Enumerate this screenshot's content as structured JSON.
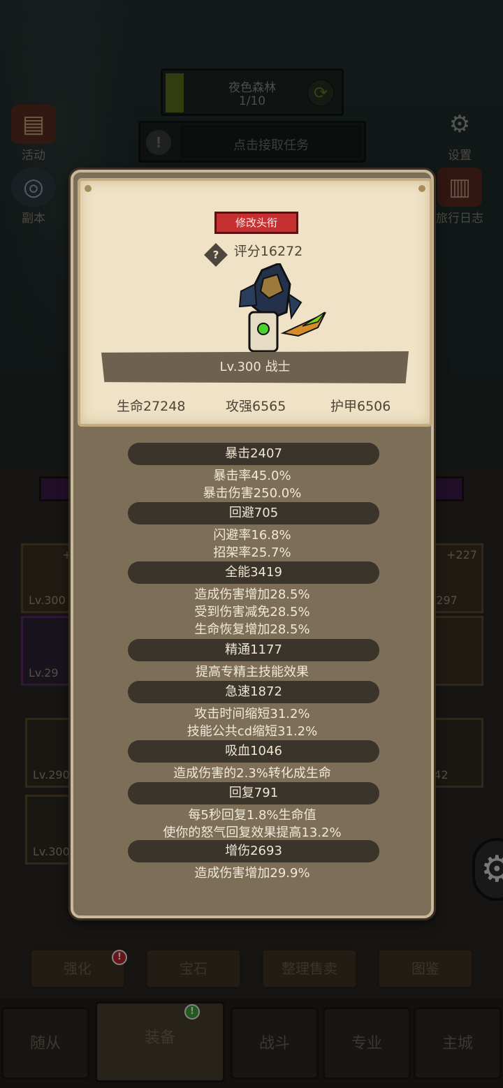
{
  "hud": {
    "level_name": "夜色森林",
    "level_progress": "1/10",
    "task_text": "点击接取任务",
    "left_buttons": [
      {
        "label": "活动",
        "icon": "scroll-icon"
      },
      {
        "label": "副本",
        "icon": "portal-icon"
      }
    ],
    "right_buttons": [
      {
        "label": "设置",
        "icon": "gear-icon"
      },
      {
        "label": "旅行日志",
        "icon": "book-icon"
      }
    ]
  },
  "background_slots": [
    {
      "lv": "Lv.300",
      "plus": "+2"
    },
    {
      "lv": "Lv.29",
      "plus": ""
    },
    {
      "lv": "v.297",
      "plus": "+227"
    },
    {
      "lv": "Lv.290",
      "plus": ""
    },
    {
      "lv": "Lv.300",
      "plus": ""
    },
    {
      "lv": "242",
      "plus": ""
    }
  ],
  "bottom_tabs": [
    "强化",
    "宝石",
    "整理售卖",
    "图鉴"
  ],
  "nav": [
    "随从",
    "装备",
    "战斗",
    "专业",
    "主城"
  ],
  "panel": {
    "title_button": "修改头衔",
    "score": "评分16272",
    "level_class": "Lv.300 战士",
    "stats": {
      "hp": "生命27248",
      "attack": "攻强6565",
      "armor": "护甲6506"
    },
    "sections": [
      {
        "header": "暴击2407",
        "lines": [
          "暴击率45.0%",
          "暴击伤害250.0%"
        ]
      },
      {
        "header": "回避705",
        "lines": [
          "闪避率16.8%",
          "招架率25.7%"
        ]
      },
      {
        "header": "全能3419",
        "lines": [
          "造成伤害增加28.5%",
          "受到伤害减免28.5%",
          "生命恢复增加28.5%"
        ]
      },
      {
        "header": "精通1177",
        "lines": [
          "提高专精主技能效果"
        ]
      },
      {
        "header": "急速1872",
        "lines": [
          "攻击时间缩短31.2%",
          "技能公共cd缩短31.2%"
        ]
      },
      {
        "header": "吸血1046",
        "lines": [
          "造成伤害的2.3%转化成生命"
        ]
      },
      {
        "header": "回复791",
        "lines": [
          "每5秒回复1.8%生命值",
          "使你的怒气回复效果提高13.2%"
        ]
      },
      {
        "header": "增伤2693",
        "lines": [
          "造成伤害增加29.9%"
        ]
      }
    ]
  },
  "colors": {
    "title_button": "#c63030",
    "panel_bg": "#7d6e58",
    "card_bg": "#efe2c6"
  }
}
